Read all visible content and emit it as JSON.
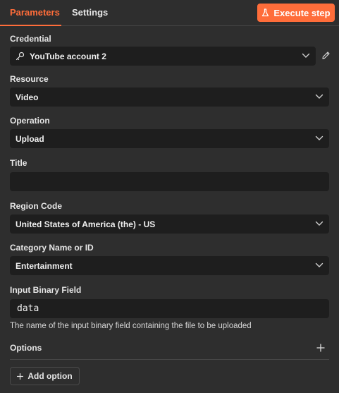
{
  "tabs": [
    {
      "label": "Parameters",
      "active": true
    },
    {
      "label": "Settings",
      "active": false
    }
  ],
  "execute_button": {
    "label": "Execute step",
    "icon": "flask-icon"
  },
  "fields": {
    "credential": {
      "label": "Credential",
      "value": "YouTube account 2",
      "icon": "key-icon",
      "edit_icon": "pencil-icon"
    },
    "resource": {
      "label": "Resource",
      "value": "Video"
    },
    "operation": {
      "label": "Operation",
      "value": "Upload"
    },
    "title": {
      "label": "Title",
      "value": ""
    },
    "region_code": {
      "label": "Region Code",
      "value": "United States of America (the) - US"
    },
    "category": {
      "label": "Category Name or ID",
      "value": "Entertainment"
    },
    "binary_field": {
      "label": "Input Binary Field",
      "value": "data",
      "hint": "The name of the input binary field containing the file to be uploaded"
    }
  },
  "options": {
    "label": "Options",
    "add_label": "Add option"
  },
  "colors": {
    "accent": "#ff6d3a",
    "background": "#2e2e2e",
    "input": "#1e1e1e"
  }
}
